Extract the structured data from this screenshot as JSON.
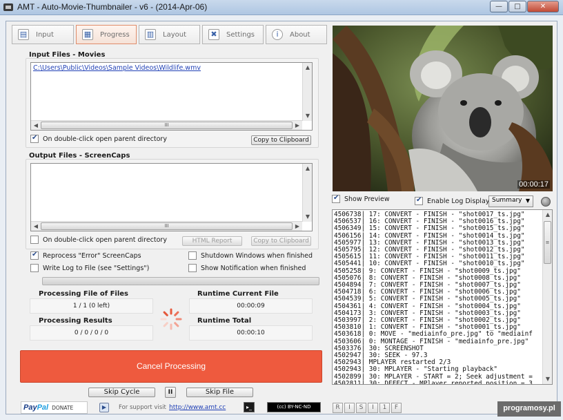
{
  "window": {
    "title": "AMT - Auto-Movie-Thumbnailer - v6 - (2014-Apr-06)",
    "minimize": "—",
    "maximize": "□",
    "close": "✕"
  },
  "tabs": [
    {
      "label": "Input",
      "icon": "input-icon"
    },
    {
      "label": "Progress",
      "icon": "progress-icon"
    },
    {
      "label": "Layout",
      "icon": "layout-icon"
    },
    {
      "label": "Settings",
      "icon": "settings-icon"
    },
    {
      "label": "About",
      "icon": "about-icon"
    }
  ],
  "active_tab": "Progress",
  "input_files": {
    "title": "Input Files - Movies",
    "items": [
      "C:\\Users\\Public\\Videos\\Sample Videos\\Wildlife.wmv"
    ],
    "open_parent_label": "On double-click open parent directory",
    "open_parent_checked": true,
    "copy_label": "Copy to Clipboard"
  },
  "output_files": {
    "title": "Output Files - ScreenCaps",
    "items": [],
    "open_parent_label": "On double-click open parent directory",
    "open_parent_checked": false,
    "html_report_label": "HTML Report",
    "copy_label": "Copy to Clipboard"
  },
  "options": {
    "reprocess_label": "Reprocess \"Error\" ScreenCaps",
    "reprocess_checked": true,
    "write_log_label": "Write Log to File (see \"Settings\")",
    "write_log_checked": false,
    "shutdown_label": "Shutdown Windows when finished",
    "shutdown_checked": false,
    "notification_label": "Show Notification when finished",
    "notification_checked": false
  },
  "progress": {
    "fraction": 0.0
  },
  "stats": {
    "processing_file_label": "Processing File of Files",
    "processing_file_value": "1 / 1 (0 left)",
    "runtime_current_label": "Runtime Current File",
    "runtime_current_value": "00:00:09",
    "processing_results_label": "Processing Results",
    "processing_results_value": "0 / 0 / 0 / 0",
    "runtime_total_label": "Runtime Total",
    "runtime_total_value": "00:00:10"
  },
  "buttons": {
    "cancel": "Cancel Processing",
    "skip_cycle": "Skip Cycle",
    "pause": "II",
    "skip_file": "Skip File"
  },
  "footer": {
    "paypal_a": "Pay",
    "paypal_b": "Pal",
    "donate": "DONATE",
    "support_text": "For support visit",
    "support_link": "http://www.amt.cc",
    "cc_label": "(cc) BY-NC-ND"
  },
  "preview": {
    "timecode": "00:00:17",
    "show_preview_label": "Show Preview",
    "show_preview_checked": true
  },
  "log": {
    "enable_label": "Enable Log Display",
    "enable_checked": true,
    "mode": "Summary",
    "lines": [
      "4506738| 17: CONVERT - FINISH - \"shot0017_ts.jpg\"",
      "4506537| 16: CONVERT - FINISH - \"shot0016_ts.jpg\"",
      "4506349| 15: CONVERT - FINISH - \"shot0015_ts.jpg\"",
      "4506156| 14: CONVERT - FINISH - \"shot0014_ts.jpg\"",
      "4505977| 13: CONVERT - FINISH - \"shot0013_ts.jpg\"",
      "4505795| 12: CONVERT - FINISH - \"shot0012_ts.jpg\"",
      "4505615| 11: CONVERT - FINISH - \"shot0011_ts.jpg\"",
      "4505441| 10: CONVERT - FINISH - \"shot0010_ts.jpg\"",
      "4505258| 9: CONVERT - FINISH - \"shot0009_ts.jpg\"",
      "4505076| 8: CONVERT - FINISH - \"shot0008_ts.jpg\"",
      "4504894| 7: CONVERT - FINISH - \"shot0007_ts.jpg\"",
      "4504718| 6: CONVERT - FINISH - \"shot0006_ts.jpg\"",
      "4504539| 5: CONVERT - FINISH - \"shot0005_ts.jpg\"",
      "4504361| 4: CONVERT - FINISH - \"shot0004_ts.jpg\"",
      "4504173| 3: CONVERT - FINISH - \"shot0003_ts.jpg\"",
      "4503997| 2: CONVERT - FINISH - \"shot0002_ts.jpg\"",
      "4503810| 1: CONVERT - FINISH - \"shot0001_ts.jpg\"",
      "4503618| 0: MOVE - \"mediainfo_pre.jpg\" to \"mediainf",
      "4503606| 0: MONTAGE - FINISH - \"mediainfo_pre.jpg\"",
      "4503376| 30: SCREENSHOT",
      "4502947| 30: SEEK - 97.3",
      "4502943| MPLAYER restarted 2/3",
      "4502943| 30: MPLAYER - \"Starting playback\"",
      "4502899| 30: MPLAYER - START = 2; Seek adjustment =",
      "4502811| 30: DEFECT - MPlayer reported position = 3"
    ]
  },
  "mini_buttons": [
    "R",
    "I",
    "S",
    "I",
    "1",
    "F"
  ],
  "watermark": "programosy.pl"
}
